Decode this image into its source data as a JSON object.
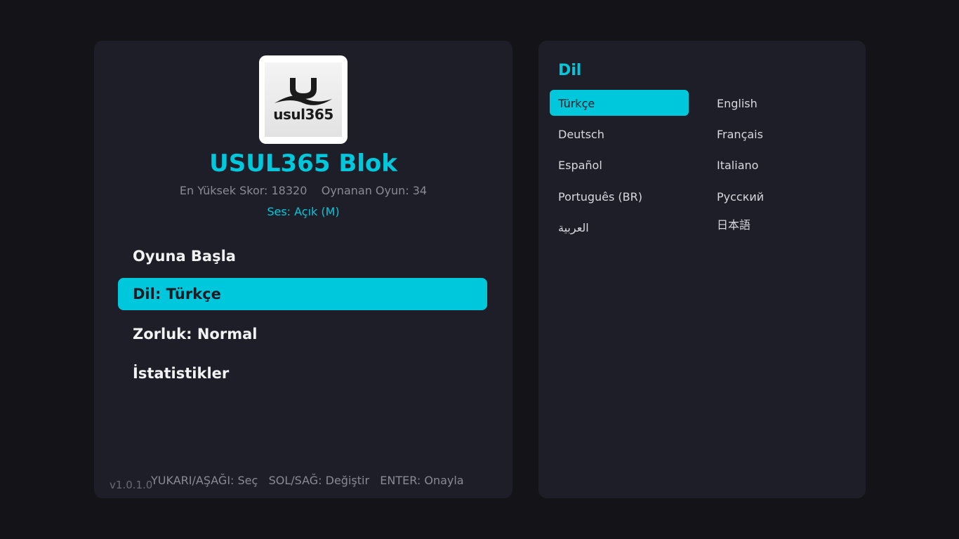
{
  "header": {
    "logo_text": "usul365",
    "title": "USUL365 Blok",
    "stats": "En Yüksek Skor: 18320    Oynanan Oyun: 34",
    "sound": "Ses: Açık (M)"
  },
  "menu": {
    "items": [
      {
        "label": "Oyuna Başla"
      },
      {
        "label": "Dil: Türkçe"
      },
      {
        "label": "Zorluk: Normal"
      },
      {
        "label": "İstatistikler"
      }
    ],
    "selected_index": 1
  },
  "footer": {
    "version": "v1.0.1.0",
    "help": "YUKARI/AŞAĞI: Seç   SOL/SAĞ: Değiştir   ENTER: Onayla"
  },
  "language_panel": {
    "title": "Dil",
    "options": [
      {
        "label": "Türkçe"
      },
      {
        "label": "English"
      },
      {
        "label": "Deutsch"
      },
      {
        "label": "Français"
      },
      {
        "label": "Español"
      },
      {
        "label": "Italiano"
      },
      {
        "label": "Português (BR)"
      },
      {
        "label": "Русский"
      },
      {
        "label": "العربية"
      },
      {
        "label": "日本語"
      }
    ],
    "selected": "Türkçe"
  },
  "colors": {
    "accent": "#00c8dc",
    "background": "#131318",
    "panel": "#1e1e28",
    "text": "#f2f2f2",
    "muted": "#8a8a94"
  }
}
